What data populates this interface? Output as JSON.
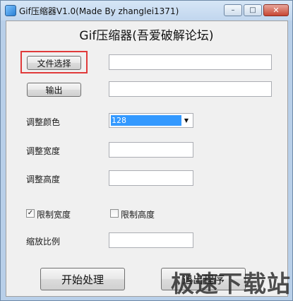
{
  "window": {
    "title": "Gif压缩器V1.0(Made By zhanglei1371)",
    "controls": {
      "minimize": "–",
      "maximize": "□",
      "close": "✕"
    }
  },
  "heading": "Gif压缩器(吾爱破解论坛)",
  "buttons": {
    "select_file": "文件选择",
    "output": "输出",
    "start": "开始处理",
    "exit": "退出程序"
  },
  "inputs": {
    "file_path": "",
    "output_path": "",
    "width": "",
    "height": "",
    "scale": ""
  },
  "labels": {
    "color": "调整颜色",
    "width": "调整宽度",
    "height": "调整高度",
    "scale": "缩放比例"
  },
  "color_select": {
    "value": "128"
  },
  "checkboxes": {
    "limit_width": {
      "label": "限制宽度",
      "checked": true
    },
    "limit_height": {
      "label": "限制高度",
      "checked": false
    }
  },
  "watermark": "极速下载站",
  "colors": {
    "highlight": "#e03a3a",
    "selection": "#3399ff"
  }
}
